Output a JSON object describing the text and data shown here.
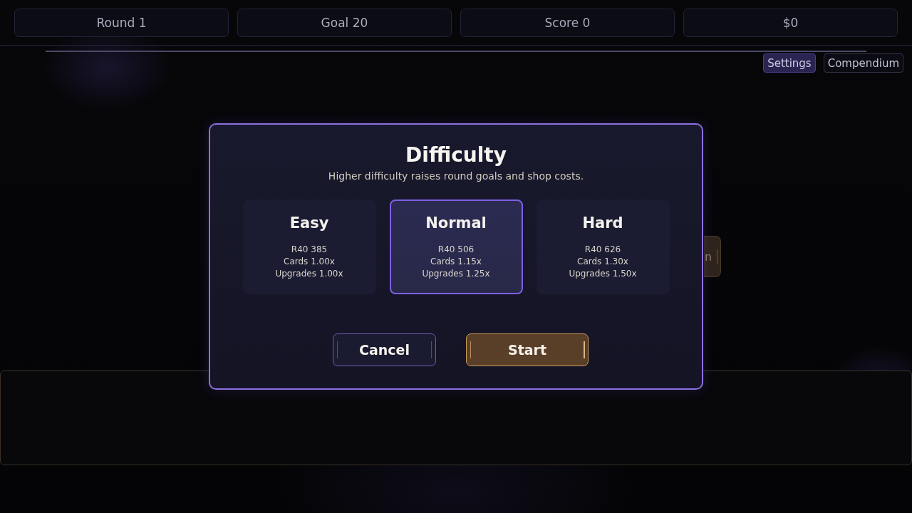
{
  "stats": [
    "Round 1",
    "Goal 20",
    "Score 0",
    "$0"
  ],
  "nav": [
    {
      "label": "Settings",
      "selected": true
    },
    {
      "label": "Compendium",
      "selected": false
    }
  ],
  "background_button": {
    "label": "n"
  },
  "dialog": {
    "title": "Difficulty",
    "subtitle": "Higher difficulty raises round goals and shop costs.",
    "options": [
      {
        "name": "Easy",
        "selected": false,
        "lines": [
          "R40 385",
          "Cards 1.00x",
          "Upgrades 1.00x"
        ]
      },
      {
        "name": "Normal",
        "selected": true,
        "lines": [
          "R40 506",
          "Cards 1.15x",
          "Upgrades 1.25x"
        ]
      },
      {
        "name": "Hard",
        "selected": false,
        "lines": [
          "R40 626",
          "Cards 1.30x",
          "Upgrades 1.50x"
        ]
      }
    ],
    "buttons": [
      {
        "label": "Cancel",
        "kind": "secondary"
      },
      {
        "label": "Start",
        "kind": "primary"
      }
    ]
  }
}
